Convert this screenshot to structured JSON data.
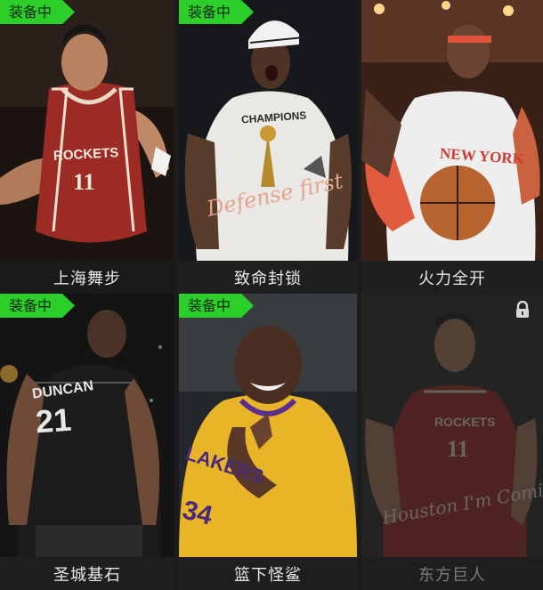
{
  "badge_label": "装备中",
  "cards": [
    {
      "title": "上海舞步",
      "equipped": true,
      "selected": true,
      "locked": false,
      "jersey_text": "ROCKETS",
      "jersey_number": "11"
    },
    {
      "title": "致命封锁",
      "equipped": true,
      "selected": false,
      "locked": false,
      "shirt_text": "CHAMPIONS",
      "overlay_text": "Defense first"
    },
    {
      "title": "火力全开",
      "equipped": false,
      "selected": false,
      "locked": false,
      "jersey_text": "NEW YORK"
    },
    {
      "title": "圣城基石",
      "equipped": true,
      "selected": false,
      "locked": false,
      "jersey_text": "DUNCAN",
      "jersey_number": "21"
    },
    {
      "title": "篮下怪鲨",
      "equipped": true,
      "selected": false,
      "locked": false,
      "jersey_text": "LAKERS",
      "jersey_number": "34"
    },
    {
      "title": "东方巨人",
      "equipped": false,
      "selected": false,
      "locked": true,
      "jersey_text": "ROCKETS",
      "jersey_number": "11",
      "overlay_text": "Houston I'm Coming"
    }
  ],
  "colors": {
    "badge_green": "#2ccf2a",
    "selected_border": "#c9952a",
    "caption_text": "#e8e8e8",
    "locked_text": "#7b7b7b"
  },
  "icons": {
    "lock": "lock-icon"
  }
}
